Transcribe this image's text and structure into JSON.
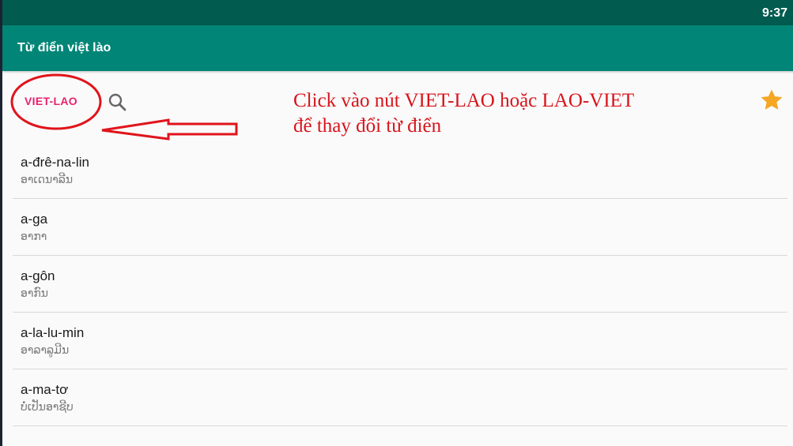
{
  "status_bar": {
    "time": "9:37"
  },
  "app_bar": {
    "title": "Từ điển việt lào"
  },
  "toolbar": {
    "language_toggle_label": "VIET-LAO",
    "search_icon": "search-icon",
    "favorite_icon": "star-icon"
  },
  "annotation": {
    "line1": "Click vào nút VIET-LAO hoặc LAO-VIET",
    "line2": "để thay đổi từ điển"
  },
  "entries": [
    {
      "word": "a-đrê-na-lin",
      "meaning": "ອາເດນາລີນ"
    },
    {
      "word": "a-ga",
      "meaning": "ອາກາ"
    },
    {
      "word": "a-gôn",
      "meaning": "ອາກົນ"
    },
    {
      "word": "a-la-lu-min",
      "meaning": "ອາລາລູມີນ"
    },
    {
      "word": "a-ma-tơ",
      "meaning": "ບໍ່ເປັນອາຊີບ"
    }
  ],
  "colors": {
    "status_bar": "#025b4f",
    "app_bar": "#018577",
    "accent_pink": "#e8226e",
    "annotation_red": "#d8141b",
    "star": "#f5a623"
  }
}
